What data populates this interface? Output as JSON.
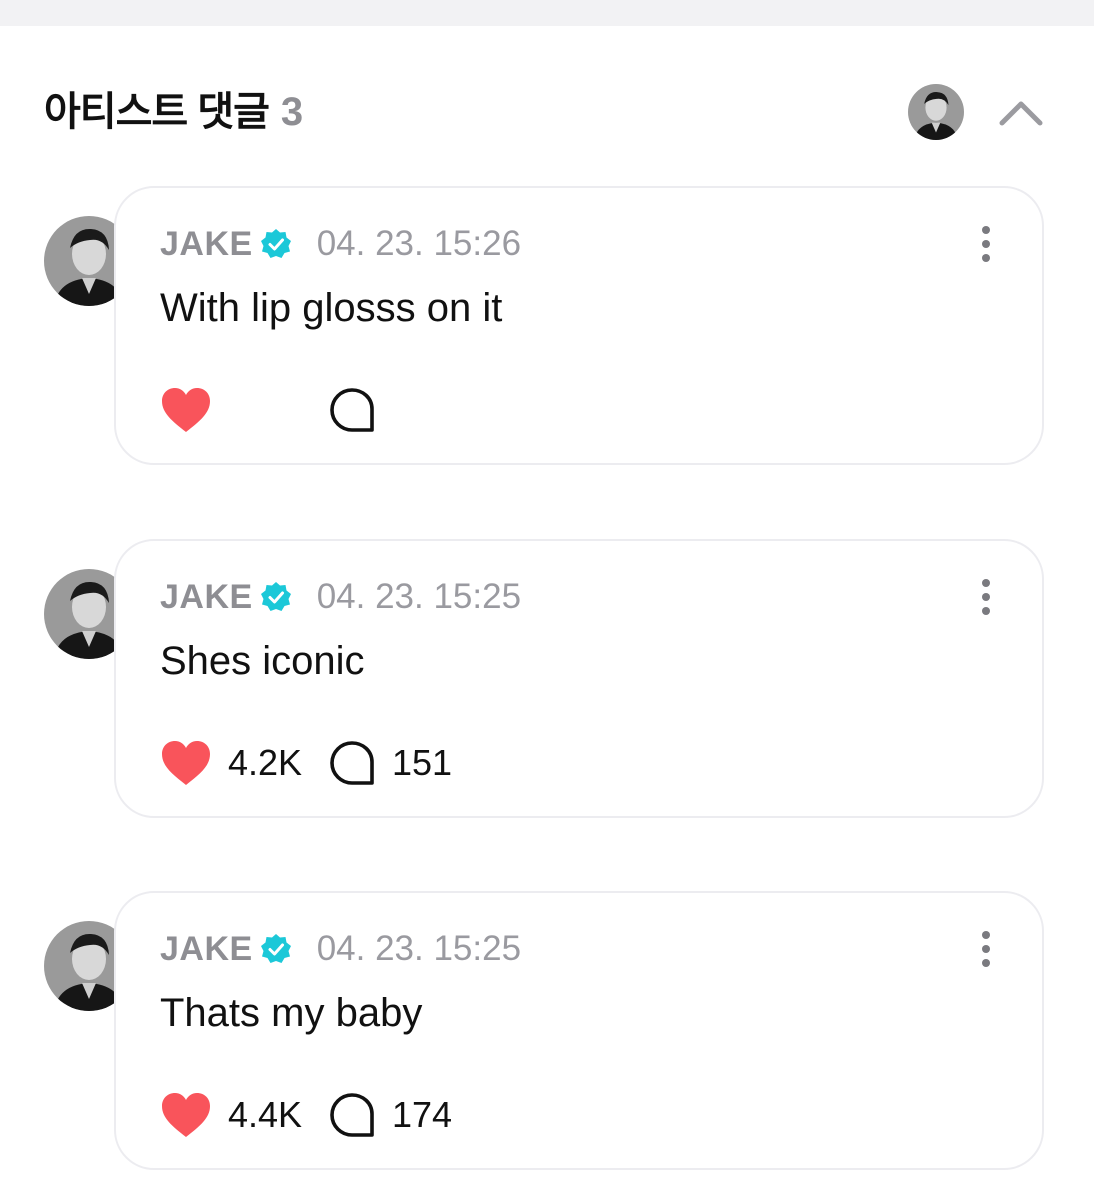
{
  "header": {
    "title": "아티스트 댓글",
    "count": "3"
  },
  "colors": {
    "heart": "#f9545b",
    "verified": "#1cc8d8",
    "muted_text": "#8e8e93",
    "card_border": "#ececf0"
  },
  "comments": [
    {
      "author": "JAKE",
      "verified": true,
      "timestamp": "04. 23. 15:26",
      "text": "With lip glosss on it",
      "likes": "",
      "replies": ""
    },
    {
      "author": "JAKE",
      "verified": true,
      "timestamp": "04. 23. 15:25",
      "text": "Shes iconic",
      "likes": "4.2K",
      "replies": "151"
    },
    {
      "author": "JAKE",
      "verified": true,
      "timestamp": "04. 23. 15:25",
      "text": "Thats my baby",
      "likes": "4.4K",
      "replies": "174"
    }
  ],
  "icons": {
    "collapse": "chevron-up-icon",
    "like": "heart-icon",
    "reply": "speech-bubble-icon",
    "more": "more-vertical-icon",
    "verified": "verified-badge-icon"
  }
}
